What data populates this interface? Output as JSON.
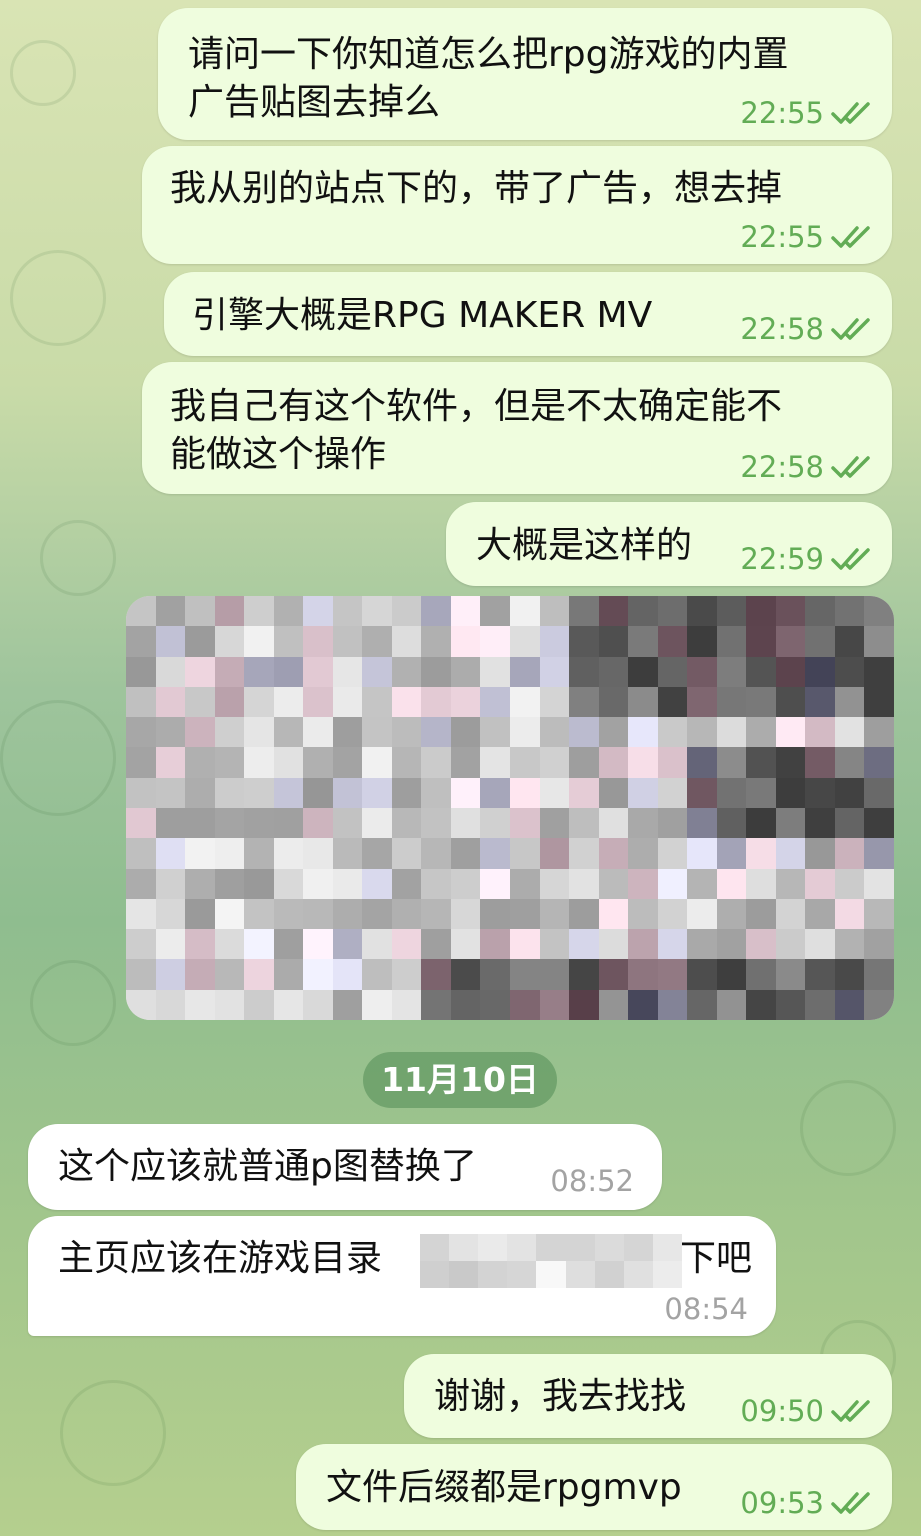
{
  "messages": [
    {
      "text": "请问一下你知道怎么把rpg游戏的内置",
      "text2": "广告贴图去掉么",
      "time": "22:55"
    },
    {
      "text": "我从别的站点下的，带了广告，想去掉",
      "time": "22:55"
    },
    {
      "text": "引擎大概是RPG MAKER MV",
      "time": "22:58"
    },
    {
      "text": "我自己有这个软件，但是不太确定能不",
      "text2": "能做这个操作",
      "time": "22:58"
    },
    {
      "text": "大概是这样的",
      "time": "22:59"
    },
    {
      "text": "这个应该就普通p图替换了",
      "time": "08:52"
    },
    {
      "text": "主页应该在游戏目录",
      "text_end": "下吧",
      "time": "08:54"
    },
    {
      "text": "谢谢，我去找找",
      "time": "09:50"
    },
    {
      "text": "文件后缀都是rpgmvp",
      "time": "09:53"
    }
  ],
  "date_separator": "11月10日",
  "colors": {
    "outgoing_bubble": "#effdde",
    "incoming_bubble": "#ffffff",
    "read_check": "#62ac55",
    "date_pill": "#6a9e6c"
  },
  "icons": {
    "read_receipt": "double-check-icon"
  }
}
